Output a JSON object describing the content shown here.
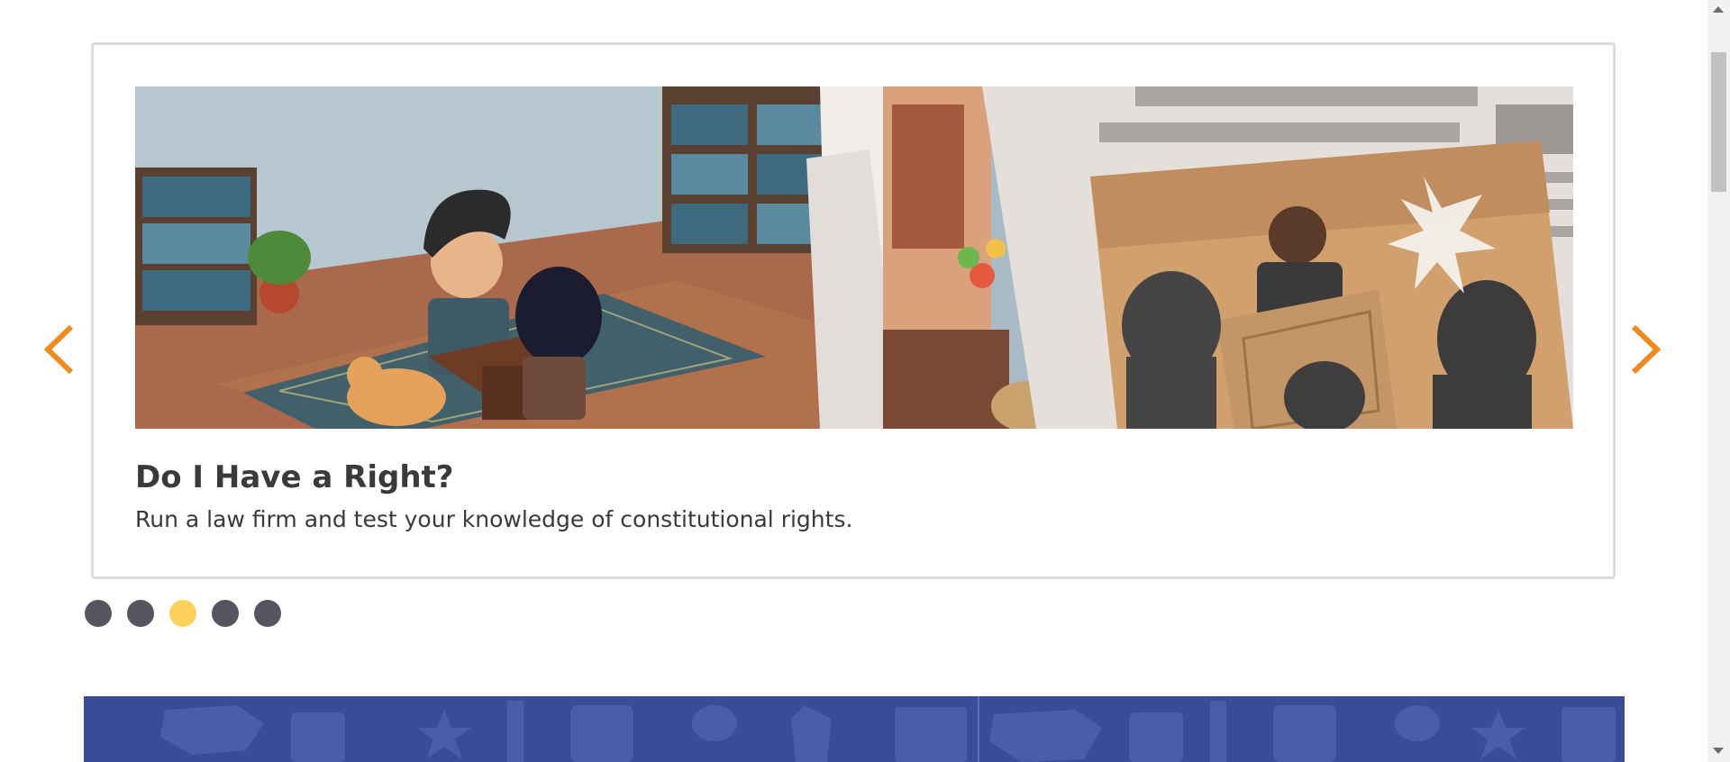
{
  "carousel": {
    "slide_title": "Do I Have a Right?",
    "slide_description": "Run a law firm and test your knowledge of constitutional rights.",
    "dot_count": 5,
    "active_dot_index": 2
  },
  "icons": {
    "prev": "chevron-left-icon",
    "next": "chevron-right-icon"
  },
  "colors": {
    "arrow": "#f08a1c",
    "active_dot": "#fdd25c",
    "inactive_dot": "#55555f",
    "banner": "#3a4b9b"
  }
}
